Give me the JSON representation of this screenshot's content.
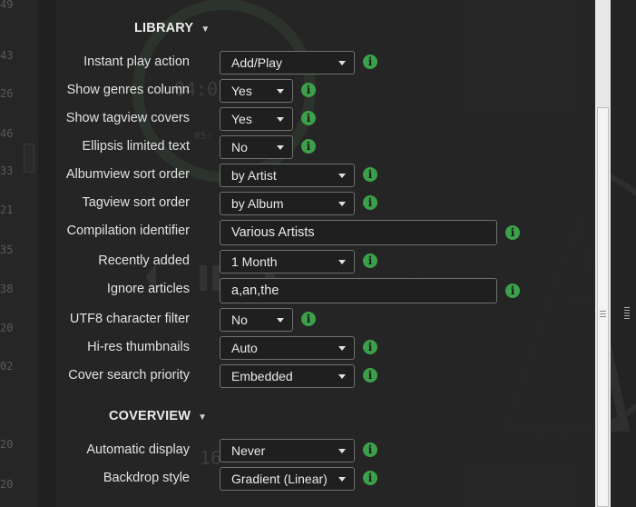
{
  "background": {
    "line_numbers": [
      "49",
      "43",
      "26",
      "46",
      "33",
      "21",
      "35",
      "38",
      "20",
      "02",
      "20",
      "20"
    ],
    "clock_time": "04:0",
    "clock_sub": "05:",
    "ghost_number": "16"
  },
  "library": {
    "title": "LIBRARY",
    "rows": [
      {
        "label": "Instant play action",
        "value": "Add/Play"
      },
      {
        "label": "Show genres column",
        "value": "Yes"
      },
      {
        "label": "Show tagview covers",
        "value": "Yes"
      },
      {
        "label": "Ellipsis limited text",
        "value": "No"
      },
      {
        "label": "Albumview sort order",
        "value": "by Artist"
      },
      {
        "label": "Tagview sort order",
        "value": "by Album"
      },
      {
        "label": "Compilation identifier",
        "value": "Various Artists"
      },
      {
        "label": "Recently added",
        "value": "1 Month"
      },
      {
        "label": "Ignore articles",
        "value": "a,an,the"
      },
      {
        "label": "UTF8 character filter",
        "value": "No"
      },
      {
        "label": "Hi-res thumbnails",
        "value": "Auto"
      },
      {
        "label": "Cover search priority",
        "value": "Embedded"
      }
    ]
  },
  "coverview": {
    "title": "COVERVIEW",
    "rows": [
      {
        "label": "Automatic display",
        "value": "Never"
      },
      {
        "label": "Backdrop style",
        "value": "Gradient (Linear)"
      }
    ]
  },
  "info_glyph": "i",
  "collapse_glyph": "▼"
}
